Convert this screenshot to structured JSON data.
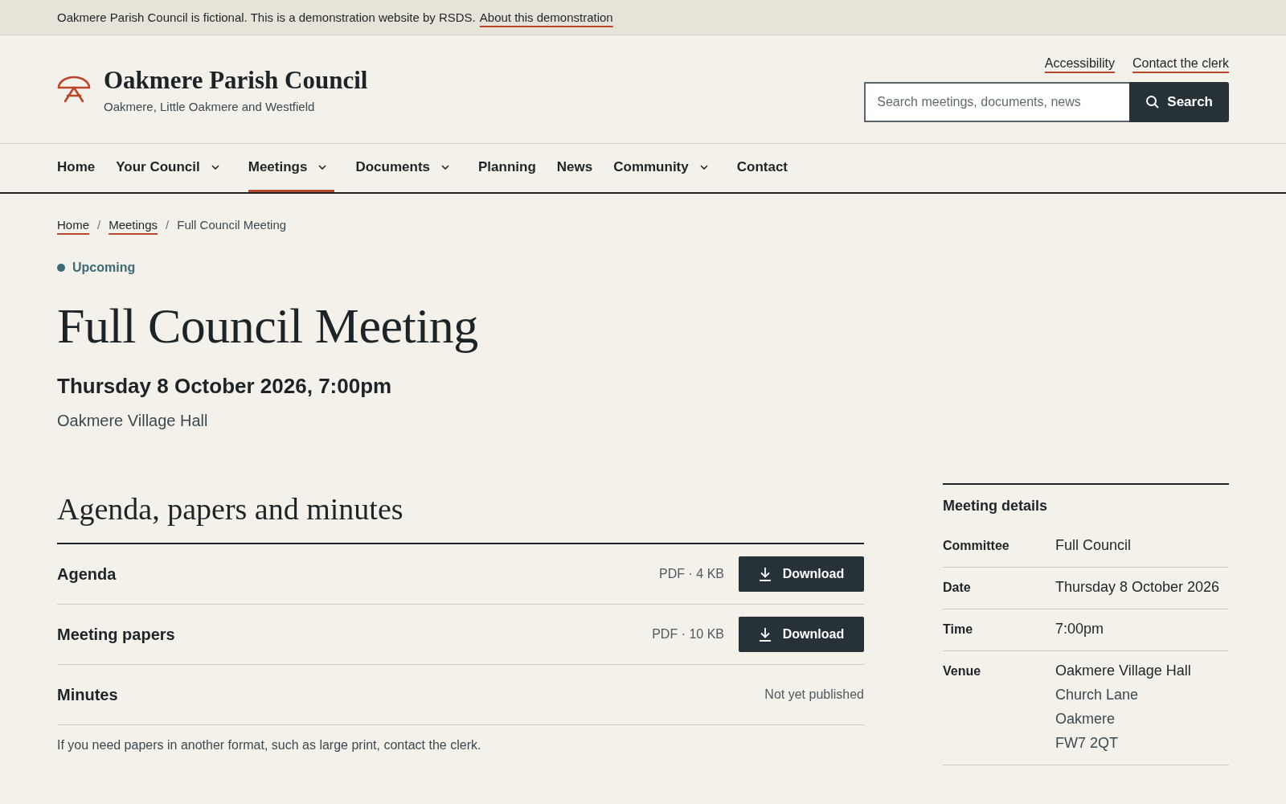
{
  "notice": {
    "text": "Oakmere Parish Council is fictional. This is a demonstration website by RSDS.",
    "link": "About this demonstration"
  },
  "site": {
    "title": "Oakmere Parish Council",
    "subtitle": "Oakmere, Little Oakmere and Westfield"
  },
  "utility_links": [
    "Accessibility",
    "Contact the clerk"
  ],
  "search": {
    "placeholder": "Search meetings, documents, news",
    "button": "Search"
  },
  "nav": [
    {
      "label": "Home",
      "dropdown": false,
      "selected": false
    },
    {
      "label": "Your Council",
      "dropdown": true,
      "selected": false
    },
    {
      "label": "Meetings",
      "dropdown": true,
      "selected": true
    },
    {
      "label": "Documents",
      "dropdown": true,
      "selected": false
    },
    {
      "label": "Planning",
      "dropdown": false,
      "selected": false
    },
    {
      "label": "News",
      "dropdown": false,
      "selected": false
    },
    {
      "label": "Community",
      "dropdown": true,
      "selected": false
    },
    {
      "label": "Contact",
      "dropdown": false,
      "selected": false
    }
  ],
  "breadcrumb_separator": "/",
  "breadcrumb": [
    {
      "label": "Home",
      "link": true
    },
    {
      "label": "Meetings",
      "link": true
    },
    {
      "label": "Full Council Meeting",
      "link": false
    }
  ],
  "status": {
    "label": "Upcoming",
    "color": "#3d6a78"
  },
  "title": "Full Council Meeting",
  "datetime": "Thursday 8 October 2026, 7:00pm",
  "venue": "Oakmere Village Hall",
  "documents": {
    "heading": "Agenda, papers and minutes",
    "items": [
      {
        "kind": "download",
        "name": "Agenda",
        "meta": "PDF · 4 KB",
        "action": "Download"
      },
      {
        "kind": "download",
        "name": "Meeting papers",
        "meta": "PDF · 10 KB",
        "action": "Download"
      },
      {
        "kind": "unpublished",
        "name": "Minutes",
        "meta": "Not yet published"
      }
    ],
    "note": "If you need papers in another format, such as large print, contact the clerk."
  },
  "details": {
    "heading": "Meeting details",
    "rows": [
      {
        "label": "Committee",
        "values": [
          "Full Council"
        ]
      },
      {
        "label": "Date",
        "values": [
          "Thursday 8 October 2026"
        ]
      },
      {
        "label": "Time",
        "values": [
          "7:00pm"
        ]
      },
      {
        "label": "Venue",
        "values": [
          "Oakmere Village Hall",
          "Church Lane",
          "Oakmere",
          "FW7 2QT"
        ]
      }
    ]
  }
}
